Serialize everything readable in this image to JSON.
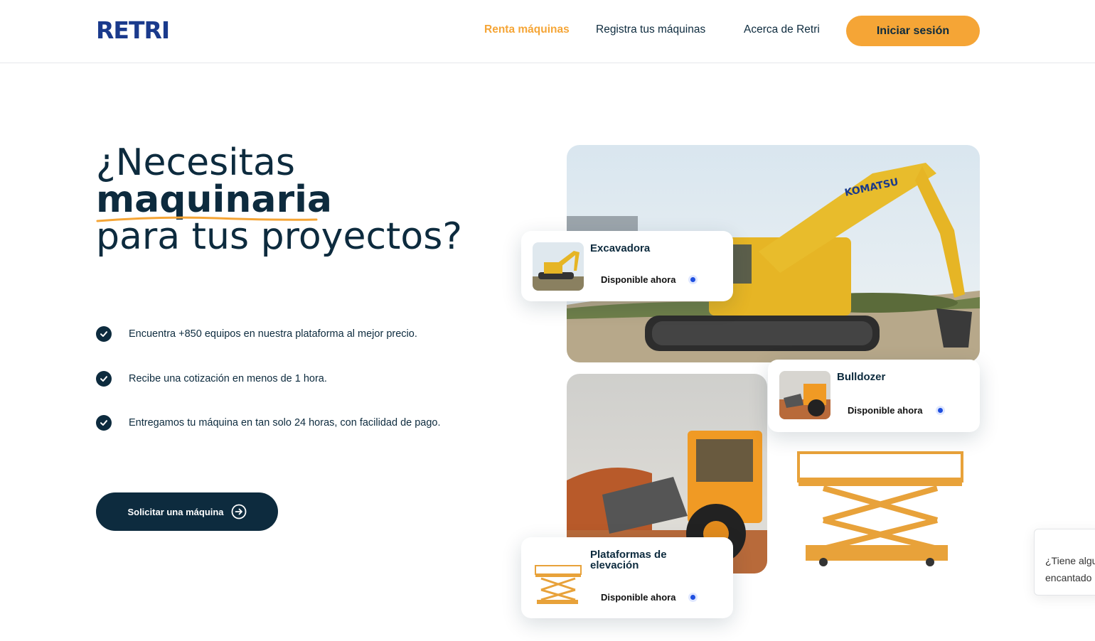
{
  "header": {
    "logo": "RETRI",
    "nav": [
      "Renta máquinas",
      "Registra tus máquinas",
      "Acerca de Retri"
    ],
    "login_label": "Iniciar sesión"
  },
  "hero": {
    "title_line1": "¿Necesitas",
    "title_line2": "maquinaria",
    "title_line3": "para tus proyectos?",
    "features": [
      "Encuentra +850 equipos en nuestra plataforma al mejor precio.",
      "Recibe una cotización en menos de 1 hora.",
      "Entregamos tu máquina en tan solo 24 horas, con facilidad de pago."
    ],
    "cta_label": "Solicitar una máquina"
  },
  "cards": [
    {
      "title": "Excavadora",
      "status": "Disponible ahora"
    },
    {
      "title": "Bulldozer",
      "status": "Disponible ahora"
    },
    {
      "title": "Plataformas de elevación",
      "status": "Disponible ahora"
    }
  ],
  "chat": {
    "text_line1": "¿Tiene algu",
    "text_line2": "encantado"
  },
  "colors": {
    "primary": "#0d2b3e",
    "accent": "#f5a536",
    "brand": "#1a3a8c",
    "status_dot": "#1f4fe0"
  },
  "icons": [
    "check-icon",
    "arrow-right-circle-icon",
    "status-dot-icon"
  ]
}
